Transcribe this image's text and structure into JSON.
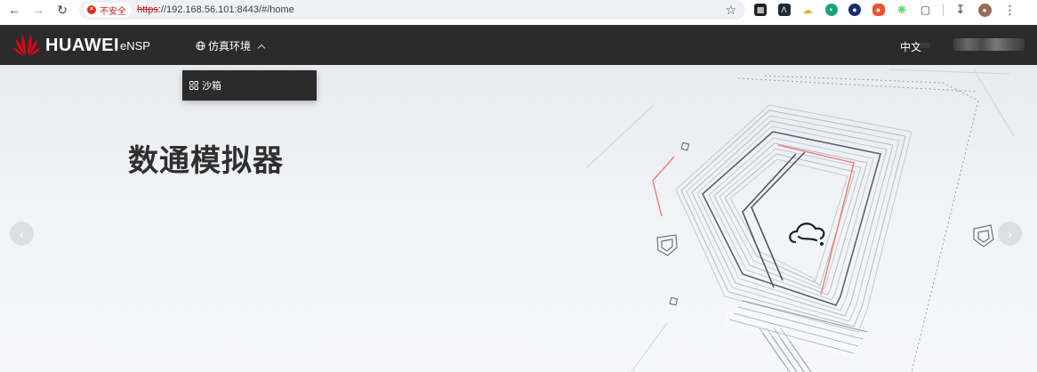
{
  "browser": {
    "back_icon": "back-arrow-icon",
    "forward_icon": "forward-arrow-icon",
    "reload_icon": "reload-icon",
    "security_label": "不安全",
    "url_scheme": "https",
    "url_rest": "://192.168.56.101:8443/#/home",
    "bookmark_icon": "star-icon",
    "menu_icon": "kebab-icon",
    "extensions": [
      {
        "name": "extension-icon-1",
        "color": "#202124"
      },
      {
        "name": "extension-icon-2",
        "color": "#1f2937"
      },
      {
        "name": "extension-icon-3",
        "color": "#f5a623"
      },
      {
        "name": "extension-icon-4",
        "color": "#1aa37a"
      },
      {
        "name": "extension-icon-5",
        "color": "#1c2b6f"
      },
      {
        "name": "extension-icon-6",
        "color": "#e8542f"
      },
      {
        "name": "extension-icon-7",
        "color": "#3ec93e"
      }
    ]
  },
  "header": {
    "brand": "HUAWEI",
    "product": "eNSP",
    "nav_label": "仿真环境",
    "language": "中文",
    "brand_color": "#e60012",
    "bar_color": "#2b2b2b"
  },
  "dropdown": {
    "items": [
      {
        "label": "沙箱",
        "icon": "grid-icon"
      }
    ]
  },
  "hero": {
    "title": "数通模拟器",
    "prev_icon": "chevron-left-icon",
    "next_icon": "chevron-right-icon"
  }
}
